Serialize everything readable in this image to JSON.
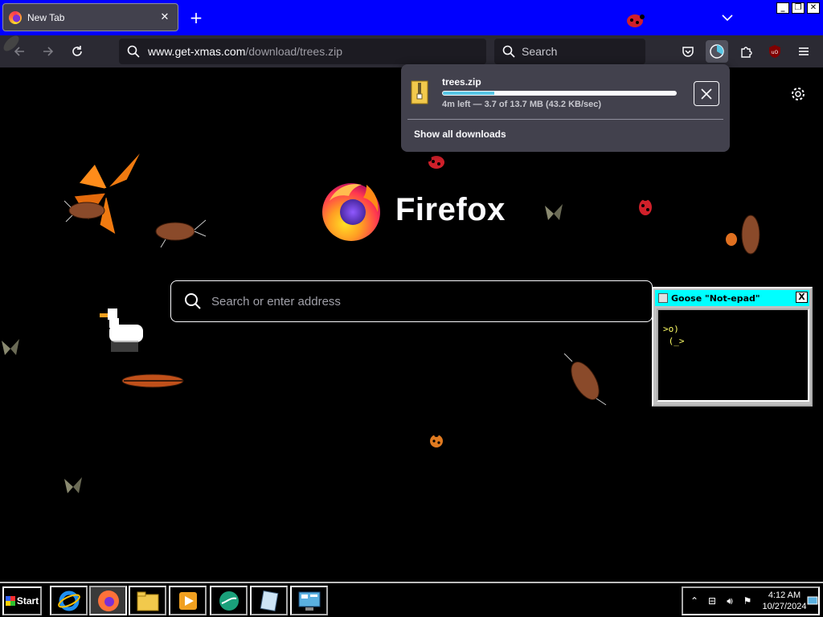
{
  "browser": {
    "tab": {
      "title": "New Tab",
      "close": "✕"
    },
    "new_tab": "+",
    "address": {
      "host": "www.get-xmas.com",
      "path": "/download/trees.zip"
    },
    "search": {
      "label": "Search"
    }
  },
  "downloads_panel": {
    "filename": "trees.zip",
    "progress_fraction": 0.22,
    "status": "4m left — 3.7 of 13.7 MB (43.2 KB/sec)",
    "show_all": "Show all downloads"
  },
  "newtab_page": {
    "logo_text": "Firefox",
    "search_placeholder": "Search or enter address"
  },
  "goose_window": {
    "title": "Goose \"Not-epad\"",
    "close": "X",
    "body": ">o)\n (_>"
  },
  "taskbar": {
    "start_label": "Start",
    "clock_time": "4:12 AM",
    "clock_date": "10/27/2024"
  },
  "colors": {
    "titlebar": "#0000ff",
    "toolbar": "#2b2a33",
    "progress": "#57c6e5",
    "goose_titlebar": "#00ffff"
  }
}
